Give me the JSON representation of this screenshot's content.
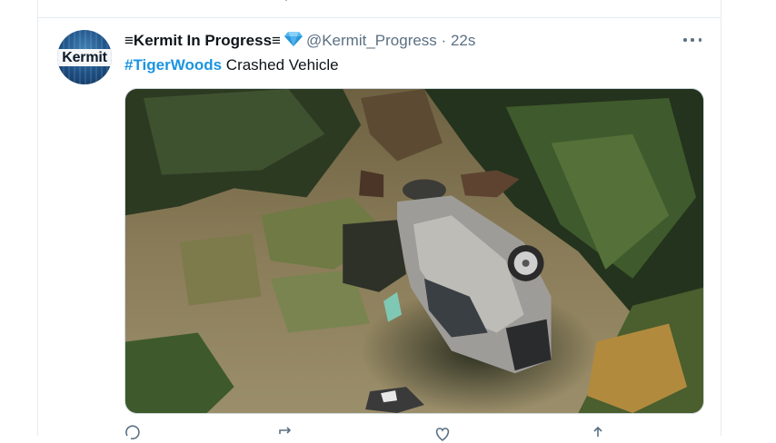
{
  "tweet": {
    "avatar_text": "Kermit",
    "display_name": "≡Kermit In Progress≡",
    "badge_icon": "diamond-icon",
    "handle": "@Kermit_Progress",
    "separator": "·",
    "timestamp": "22s",
    "hashtag": "#TigerWoods",
    "text": " Crashed Vehicle",
    "media_description_icon": "photo"
  },
  "actions": [
    "reply-icon",
    "retweet-icon",
    "like-icon",
    "share-icon"
  ],
  "colors": {
    "hashtag": "#1b95e0",
    "secondary_text": "#5b7083",
    "border": "#e6ecf0",
    "diamond": "#4fb3f0"
  }
}
